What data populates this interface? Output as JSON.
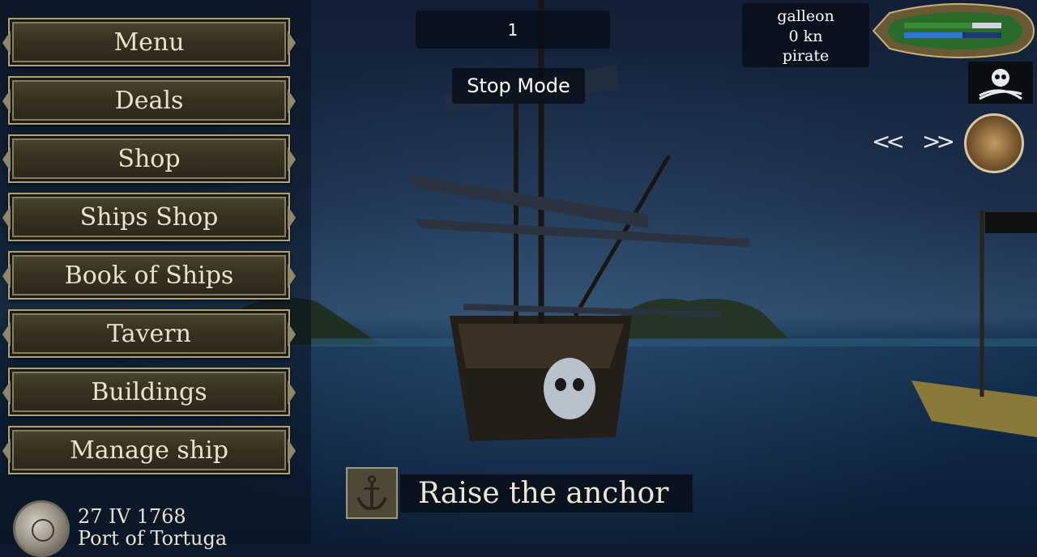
{
  "menu": {
    "items": [
      {
        "label": "Menu"
      },
      {
        "label": "Deals"
      },
      {
        "label": "Shop"
      },
      {
        "label": "Ships Shop"
      },
      {
        "label": "Book of Ships"
      },
      {
        "label": "Tavern"
      },
      {
        "label": "Buildings"
      },
      {
        "label": "Manage ship"
      }
    ]
  },
  "status": {
    "date": "27 IV 1768",
    "location": "Port of Tortuga"
  },
  "hud": {
    "speed_value": "1",
    "mode_label": "Stop Mode",
    "ship_type": "galleon",
    "ship_speed": "0 kn",
    "ship_faction": "pirate",
    "prev_label": "<<",
    "next_label": ">>"
  },
  "gauge": {
    "hull_fraction": 0.7,
    "crew_fraction": 0.6
  },
  "action": {
    "anchor_label": "Raise the anchor"
  },
  "icons": {
    "clock": "clock-icon",
    "flag": "jolly-roger-icon",
    "map": "map-icon",
    "anchor": "anchor-icon"
  },
  "colors": {
    "button_text": "#e8e2cf",
    "hull_bar": "#3a8a3a",
    "crew_bar": "#2f78d0"
  }
}
